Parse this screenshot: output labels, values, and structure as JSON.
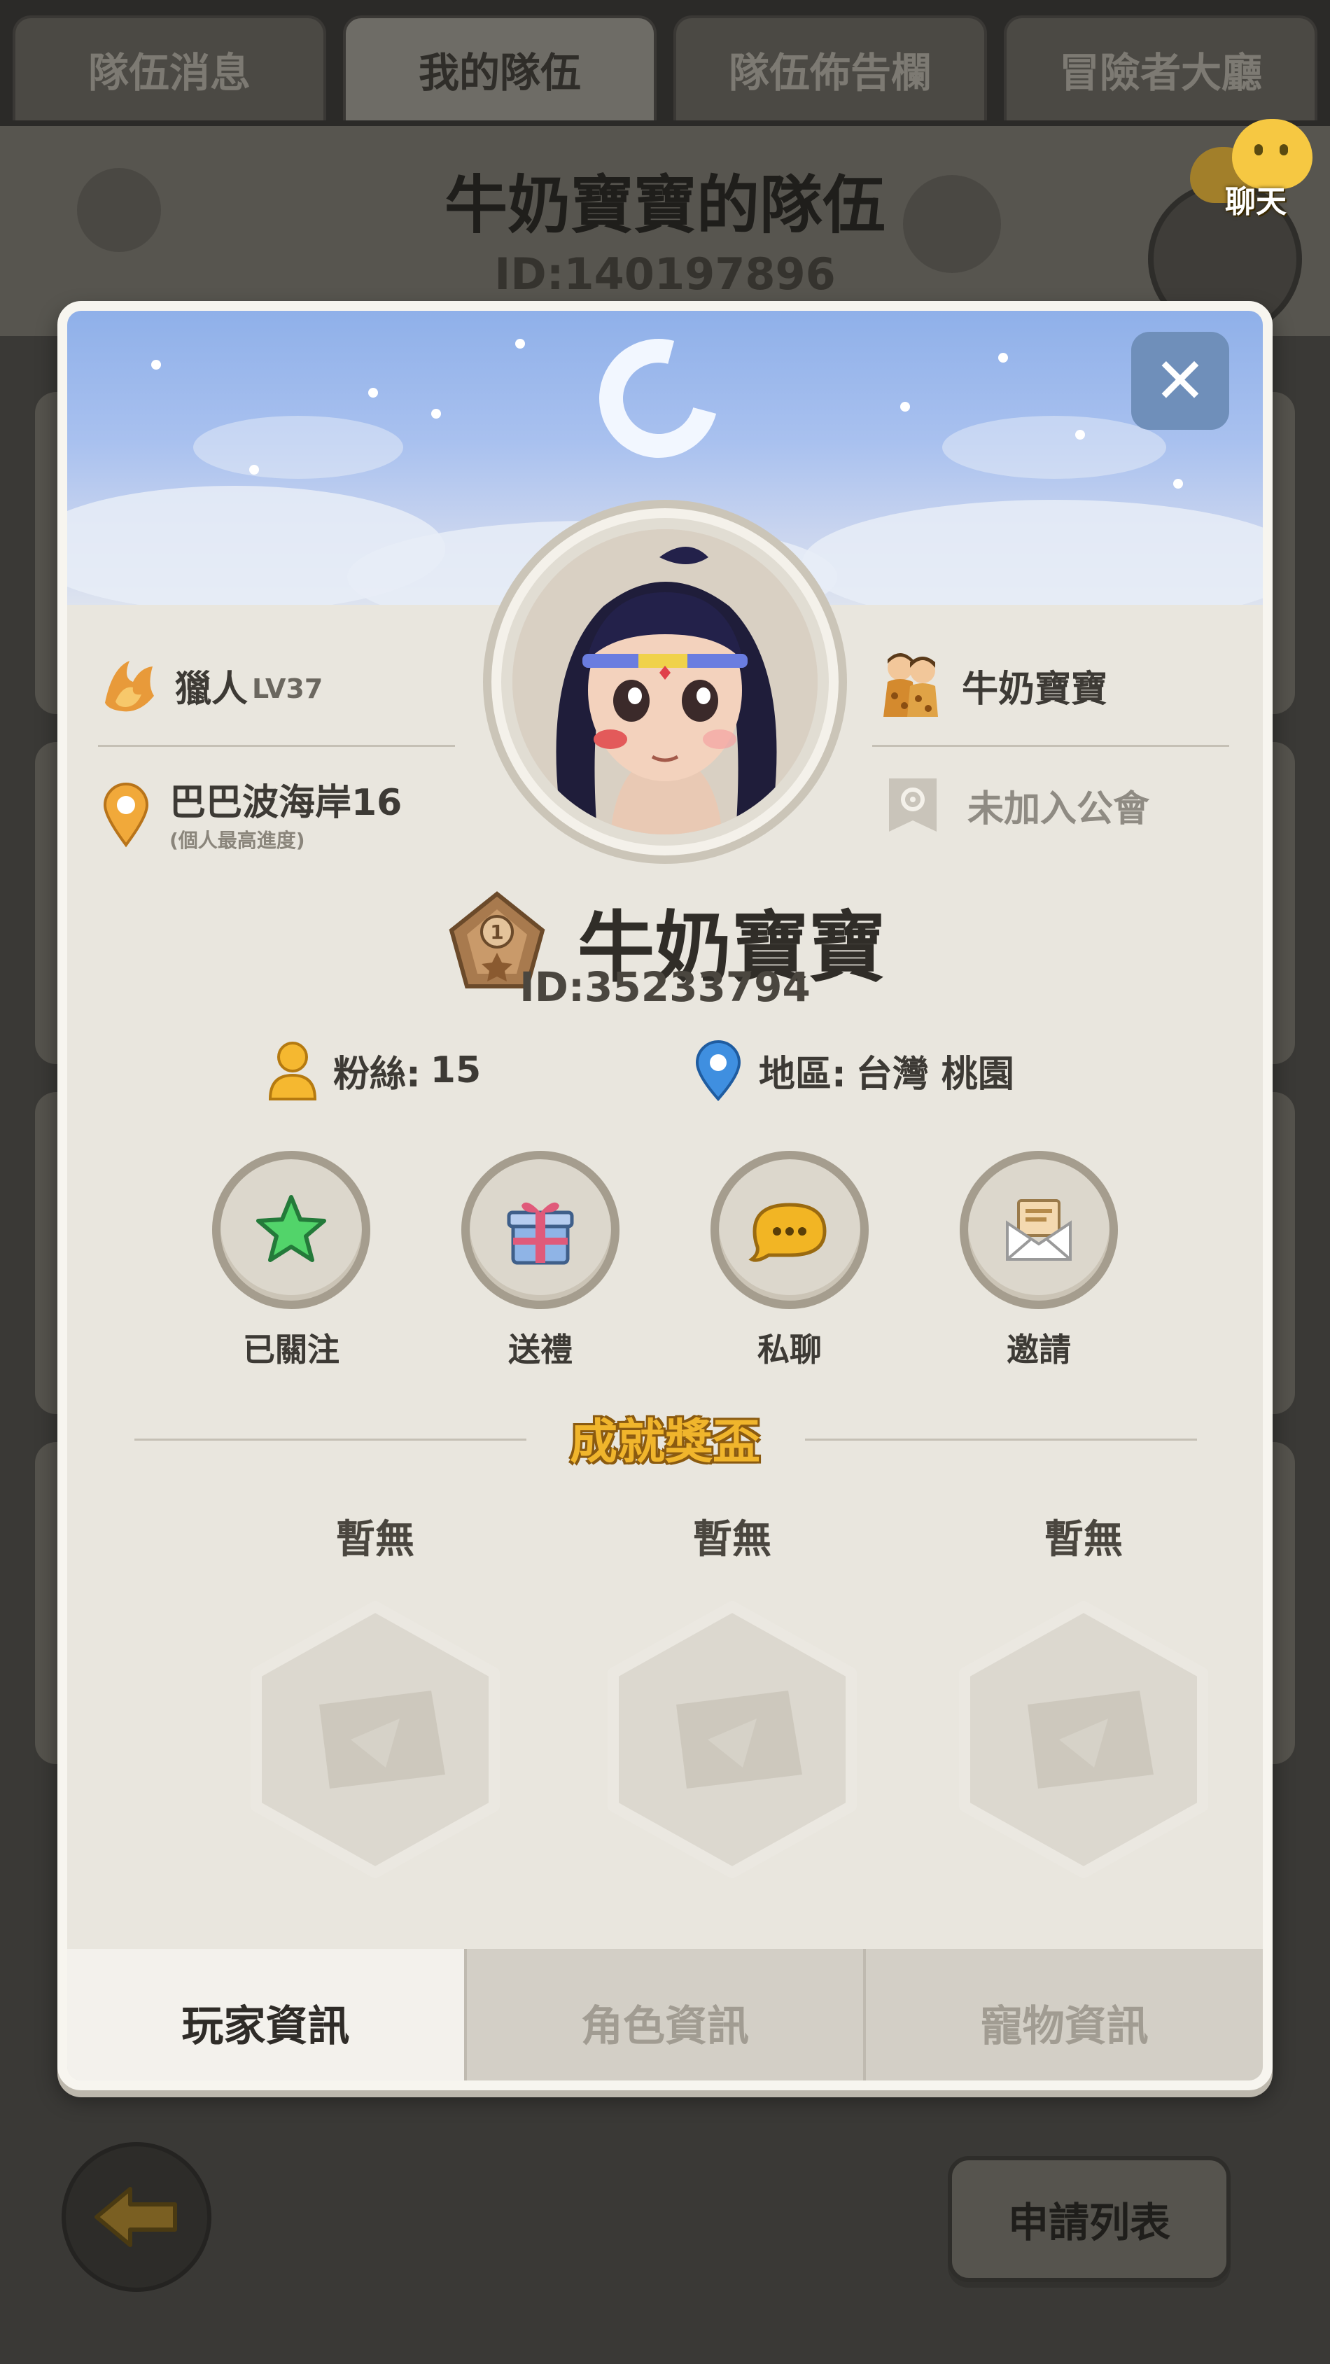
{
  "top_tabs": [
    {
      "label": "隊伍消息",
      "active": false
    },
    {
      "label": "我的隊伍",
      "active": true
    },
    {
      "label": "隊伍佈告欄",
      "active": false
    },
    {
      "label": "冒險者大廳",
      "active": false
    }
  ],
  "team": {
    "title": "牛奶寶寶的隊伍",
    "id": "ID:140197896"
  },
  "chat_button": {
    "label": "聊天",
    "icon": "chat-bubble-icon"
  },
  "profile": {
    "job": "獵人",
    "level": "LV37",
    "location": "巴巴波海岸16",
    "location_note": "(個人最高進度)",
    "partner_name": "牛奶寶寶",
    "guild": "未加入公會",
    "name": "牛奶寶寶",
    "id": "ID:35233794",
    "fans_label": "粉絲:",
    "fans_count": "15",
    "region_label": "地區:",
    "region_value": "台灣 桃園"
  },
  "actions": [
    {
      "label": "已關注",
      "icon": "star-icon"
    },
    {
      "label": "送禮",
      "icon": "gift-icon"
    },
    {
      "label": "私聊",
      "icon": "chat-bubble-icon"
    },
    {
      "label": "邀請",
      "icon": "envelope-icon"
    }
  ],
  "achievements": {
    "title": "成就獎盃",
    "slots": [
      {
        "label": "暫無"
      },
      {
        "label": "暫無"
      },
      {
        "label": "暫無"
      }
    ]
  },
  "bottom_tabs": [
    {
      "label": "玩家資訊",
      "active": true
    },
    {
      "label": "角色資訊",
      "active": false
    },
    {
      "label": "寵物資訊",
      "active": false
    }
  ],
  "footer": {
    "apply_list_label": "申請列表",
    "back_icon": "back-arrow-icon"
  },
  "colors": {
    "accent_gold": "#f0b52c",
    "close_button": "#6f8fba",
    "card_background": "#e9e6de"
  }
}
